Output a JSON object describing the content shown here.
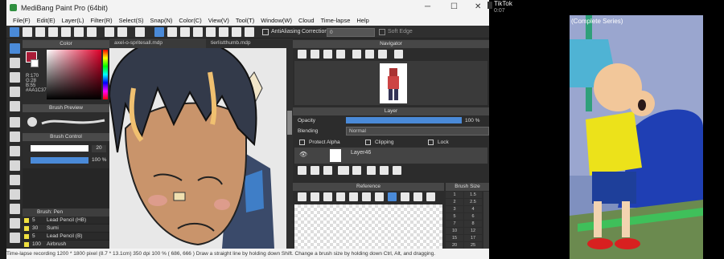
{
  "window": {
    "title": "MediBang Paint Pro (64bit)"
  },
  "menu": [
    "File(F)",
    "Edit(E)",
    "Layer(L)",
    "Filter(R)",
    "Select(S)",
    "Snap(N)",
    "Color(C)",
    "View(V)",
    "Tool(T)",
    "Window(W)",
    "Cloud",
    "Time-lapse",
    "Help"
  ],
  "toolbar": {
    "antialiasing": "AntiAliasing",
    "correction_label": "Correction",
    "correction_value": "0",
    "soft_edge": "Soft Edge"
  },
  "color_panel": {
    "title": "Color",
    "r": "R:170",
    "g": "G:28",
    "b": "B:55",
    "hex": "#AA1C37"
  },
  "brush_preview": {
    "title": "Brush Preview"
  },
  "brush_control": {
    "title": "Brush Control",
    "size": "20",
    "opacity": "100 %"
  },
  "brush_list": {
    "title": "Brush: Pen",
    "items": [
      {
        "size": "5",
        "name": "Lead Pencil (HB)"
      },
      {
        "size": "30",
        "name": "Sumi"
      },
      {
        "size": "5",
        "name": "Lead Pencil (B)"
      },
      {
        "size": "100",
        "name": "Airbrush"
      }
    ]
  },
  "tabs": [
    "axel-o-spritesall.mdp",
    "tierlistthumb.mdp"
  ],
  "navigator": {
    "title": "Navigator"
  },
  "layer": {
    "title": "Layer",
    "opacity_label": "Opacity",
    "opacity_value": "100 %",
    "blending_label": "Blending",
    "blending_value": "Normal",
    "protect_alpha": "Protect Alpha",
    "clipping": "Clipping",
    "lock": "Lock",
    "layer_name": "Layer46"
  },
  "reference": {
    "title": "Reference"
  },
  "brush_size": {
    "title": "Brush Size",
    "values": [
      "1",
      "1.5",
      "2",
      "2.5",
      "3",
      "4",
      "5",
      "6",
      "7",
      "8",
      "10",
      "12",
      "15",
      "17",
      "20",
      "25"
    ]
  },
  "status": {
    "text": "Time-lapse recording   1200 * 1800 pixel  (8.7 * 13.1cm)  350 dpi  100 %  ( 686, 666 )   Draw a straight line by holding down Shift. Change a brush size by holding down Ctrl, Alt, and dragging."
  },
  "tiktok": {
    "app": "TikTok",
    "time": "0:07",
    "caption": "(Complete Series)"
  },
  "colors": {
    "accent": "#4a8ad8",
    "primary_color": "#AA1C37"
  }
}
